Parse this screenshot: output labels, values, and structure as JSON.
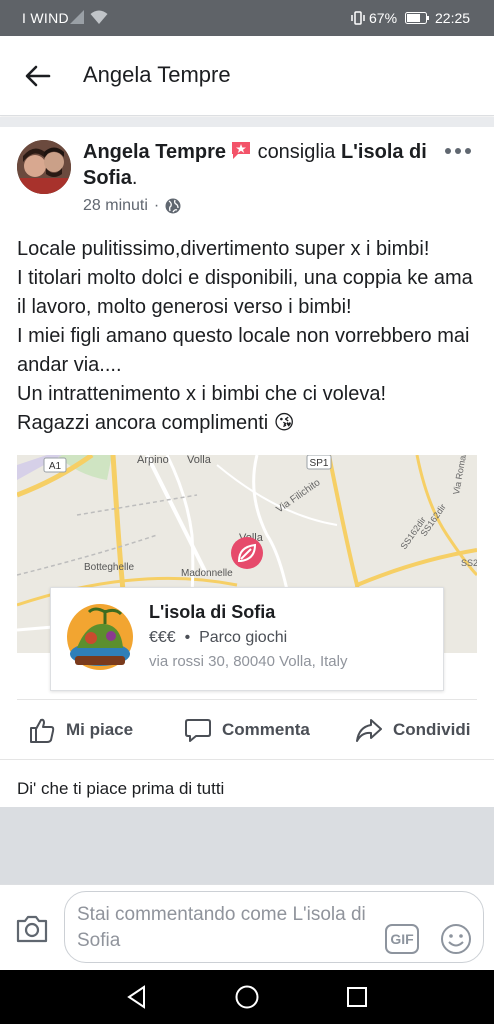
{
  "status": {
    "carrier": "I WIND",
    "battery_pct": "67%",
    "time": "22:25"
  },
  "header": {
    "title": "Angela Tempre"
  },
  "post": {
    "author": "Angela Tempre",
    "verb": "consiglia",
    "page_name": "L'isola di Sofia",
    "period": ".",
    "time_ago": "28 minuti",
    "separator": "·",
    "text": "Locale pulitissimo,divertimento super x i bimbi!\nI titolari molto dolci e disponibili, una coppia ke ama il lavoro, molto generosi verso i bimbi!\nI miei figli amano questo locale non vorrebbero mai andar via....\nUn intrattenimento x i bimbi che ci voleva!\nRagazzi ancora complimenti 😘"
  },
  "map": {
    "labels": {
      "a1": "A1",
      "arpino": "Arpino",
      "volla_top": "Volla",
      "sp1": "SP1",
      "via_filichito": "Via Filichito",
      "via_romani": "Via Romani",
      "volla": "Volla",
      "ss162": "SS162dir",
      "ss162_2": "SS162dir",
      "botteghelle": "Botteghelle",
      "madonnelle": "Madonnelle",
      "ss2": "SS2"
    }
  },
  "place": {
    "name": "L'isola di Sofia",
    "price": "€€€",
    "dot": "•",
    "category": "Parco giochi",
    "address": "via rossi 30, 80040 Volla, Italy"
  },
  "actions": {
    "like": "Mi piace",
    "comment": "Commenta",
    "share": "Condividi"
  },
  "likes_first": "Di' che ti piace prima di tutti",
  "composer": {
    "placeholder": "Stai commentando come L'isola di Sofia",
    "gif": "GIF"
  },
  "colors": {
    "accent": "#4267b2",
    "pin": "#e64a6b",
    "status_bar": "#5f6368"
  }
}
